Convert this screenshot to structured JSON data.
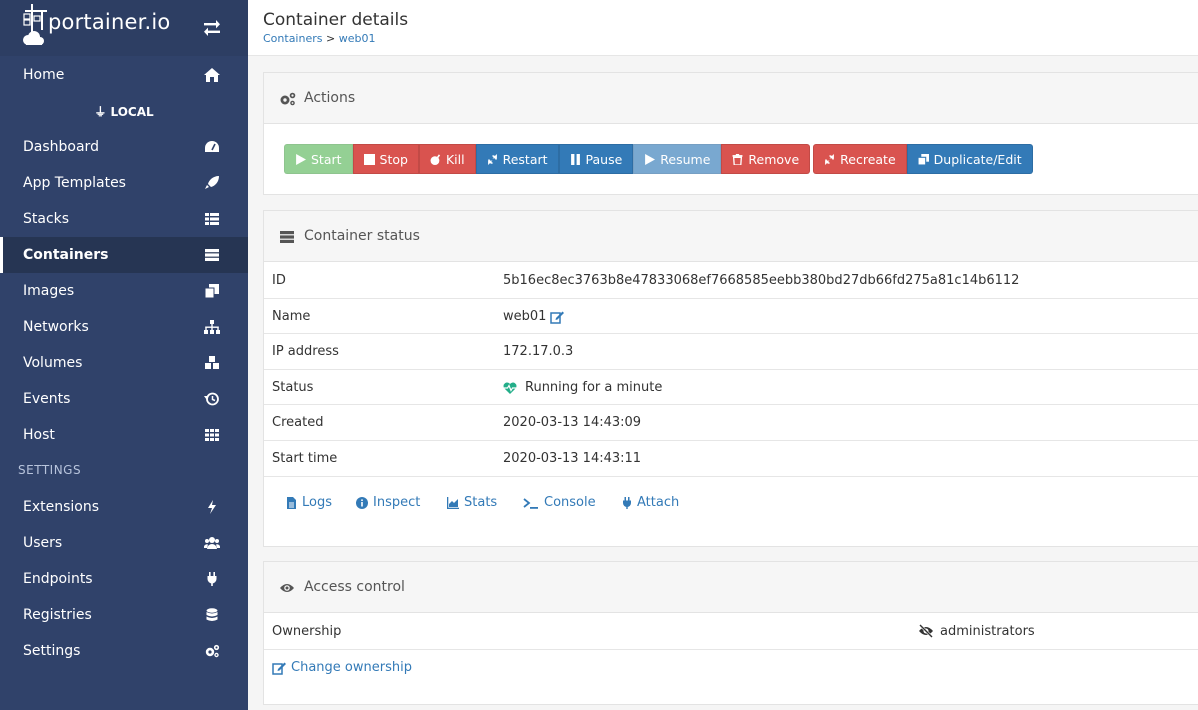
{
  "brand": {
    "name": "portainer.io"
  },
  "sidebar": {
    "home": "Home",
    "endpoint": "LOCAL",
    "items": [
      {
        "label": "Dashboard",
        "icon": "tachometer-icon"
      },
      {
        "label": "App Templates",
        "icon": "rocket-icon"
      },
      {
        "label": "Stacks",
        "icon": "th-list-icon"
      },
      {
        "label": "Containers",
        "icon": "server-icon"
      },
      {
        "label": "Images",
        "icon": "clone-icon"
      },
      {
        "label": "Networks",
        "icon": "sitemap-icon"
      },
      {
        "label": "Volumes",
        "icon": "cubes-icon"
      },
      {
        "label": "Events",
        "icon": "history-icon"
      },
      {
        "label": "Host",
        "icon": "th-icon"
      }
    ],
    "settings_heading": "SETTINGS",
    "settings_items": [
      {
        "label": "Extensions",
        "icon": "bolt-icon"
      },
      {
        "label": "Users",
        "icon": "users-icon"
      },
      {
        "label": "Endpoints",
        "icon": "plug-icon"
      },
      {
        "label": "Registries",
        "icon": "database-icon"
      },
      {
        "label": "Settings",
        "icon": "cogs-icon"
      }
    ],
    "active": "Containers"
  },
  "header": {
    "title": "Container details",
    "breadcrumb": {
      "parent": "Containers",
      "separator": ">",
      "current": "web01"
    }
  },
  "actions": {
    "title": "Actions",
    "buttons": {
      "start": "Start",
      "stop": "Stop",
      "kill": "Kill",
      "restart": "Restart",
      "pause": "Pause",
      "resume": "Resume",
      "remove": "Remove",
      "recreate": "Recreate",
      "duplicate": "Duplicate/Edit"
    }
  },
  "status": {
    "title": "Container status",
    "rows": [
      {
        "key": "ID",
        "value": "5b16ec8ec3763b8e47833068ef7668585eebb380bd27db66fd275a81c14b6112"
      },
      {
        "key": "Name",
        "value": "web01"
      },
      {
        "key": "IP address",
        "value": "172.17.0.3"
      },
      {
        "key": "Status",
        "value": "Running for a minute"
      },
      {
        "key": "Created",
        "value": "2020-03-13 14:43:09"
      },
      {
        "key": "Start time",
        "value": "2020-03-13 14:43:11"
      }
    ],
    "links": {
      "logs": "Logs",
      "inspect": "Inspect",
      "stats": "Stats",
      "console": "Console",
      "attach": "Attach"
    }
  },
  "access": {
    "title": "Access control",
    "ownership_label": "Ownership",
    "ownership_value": "administrators",
    "change_link": "Change ownership"
  },
  "colors": {
    "sidebar": "#30426a",
    "primary": "#337ab7",
    "danger": "#d9534f",
    "success": "#5cb85c",
    "status_running": "#23ae89"
  }
}
